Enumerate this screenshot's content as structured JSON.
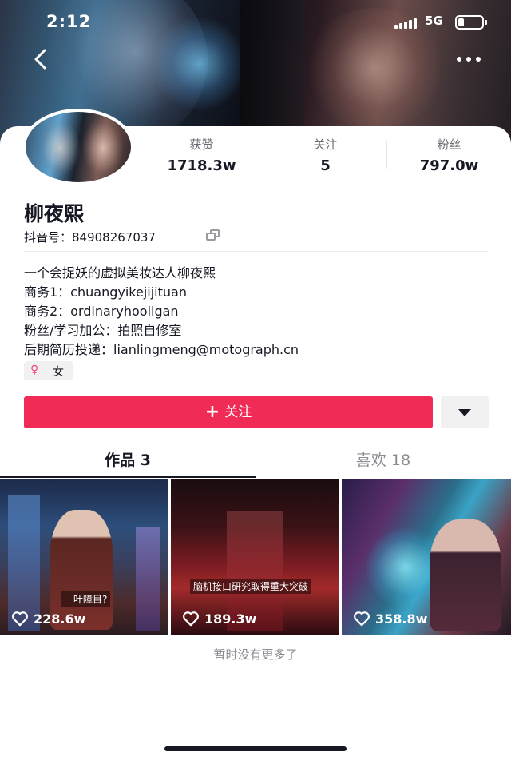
{
  "status_bar": {
    "time": "2:12",
    "network": "5G",
    "battery_level": 0.25
  },
  "header": {
    "back_icon": "chevron-left-icon",
    "more_icon": "more-horizontal-icon"
  },
  "profile": {
    "name": "柳夜熙",
    "douyin_id": "抖音号：84908267037",
    "stats": [
      {
        "label": "获赞",
        "value": "1718.3w"
      },
      {
        "label": "关注",
        "value": "5"
      },
      {
        "label": "粉丝",
        "value": "797.0w"
      }
    ],
    "bio_lines": [
      "一个会捉妖的虚拟美妆达人柳夜熙",
      "商务1：chuangyikejijituan",
      "商务2：ordinaryhooligan",
      "粉丝/学习加公：拍照自修室",
      "后期简历投递：lianlingmeng@motograph.cn"
    ],
    "gender_symbol": "♀",
    "gender": "女"
  },
  "actions": {
    "follow_plus": "+",
    "follow_label": "关注",
    "dropdown_icon": "caret-down-icon"
  },
  "tabs": [
    {
      "label": "作品 3",
      "active": true
    },
    {
      "label": "喜欢 18",
      "active": false
    }
  ],
  "videos": [
    {
      "caption": "一叶障目?",
      "likes": "228.6w"
    },
    {
      "caption": "脑机接口研究取得重大突破",
      "likes": "189.3w"
    },
    {
      "caption": "",
      "likes": "358.8w"
    }
  ],
  "footer": {
    "no_more": "暂时没有更多了"
  },
  "colors": {
    "accent": "#f02c56",
    "text": "#161823",
    "secondary_text": "#8a8a90"
  }
}
